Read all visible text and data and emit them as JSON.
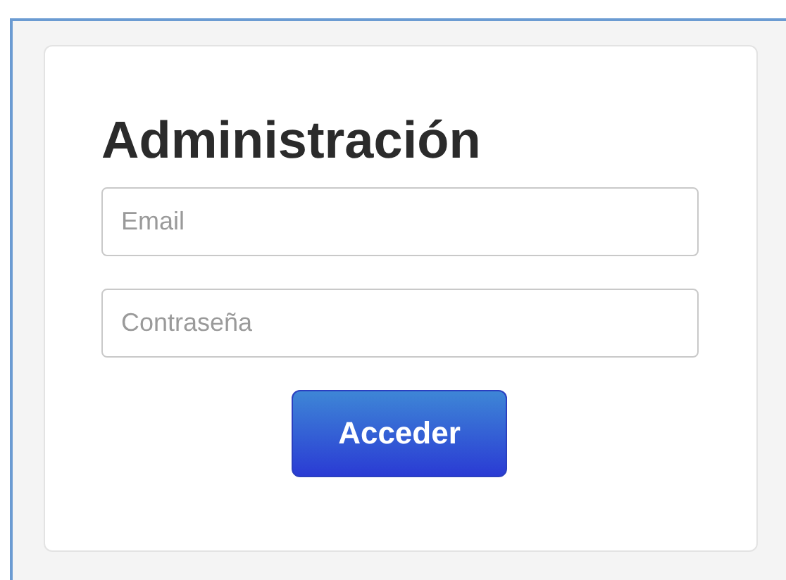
{
  "title": "Administración",
  "fields": [
    {
      "placeholder": "Email"
    },
    {
      "placeholder": "Contraseña"
    }
  ],
  "button": "Acceder"
}
